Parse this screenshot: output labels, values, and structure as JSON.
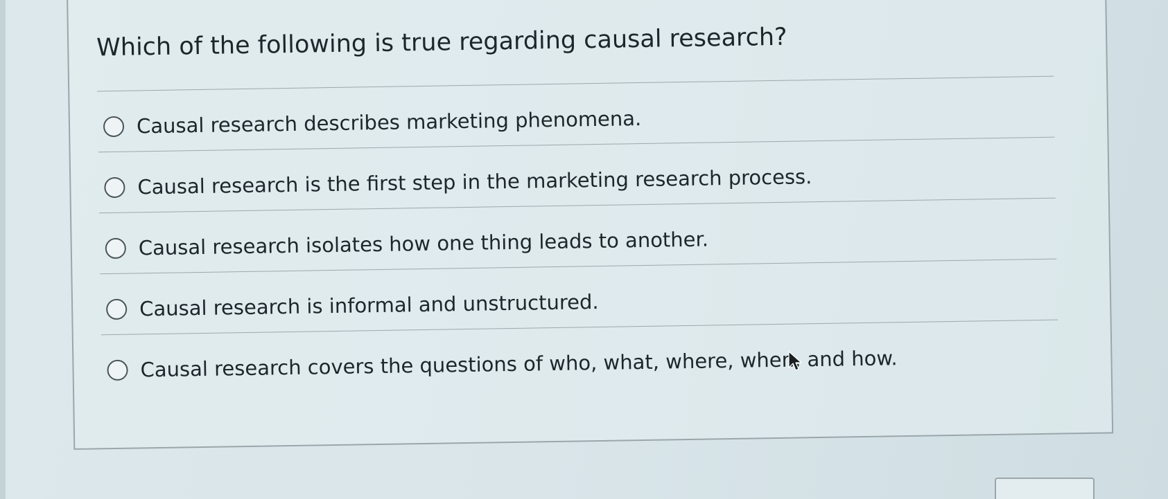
{
  "question": {
    "title": "Which of the following is true regarding causal research?"
  },
  "options": [
    {
      "label": "Causal research describes marketing phenomena.",
      "selected": false
    },
    {
      "label": "Causal research is the first step in the marketing research process.",
      "selected": false
    },
    {
      "label": "Causal research isolates how one thing leads to another.",
      "selected": false
    },
    {
      "label": "Causal research is informal and unstructured.",
      "selected": false
    },
    {
      "label": "Causal research covers the questions of who, what, where, when, and how.",
      "selected": false
    }
  ],
  "icons": {
    "cursor": "mouse-pointer-icon",
    "radio": "radio-unchecked-icon"
  }
}
